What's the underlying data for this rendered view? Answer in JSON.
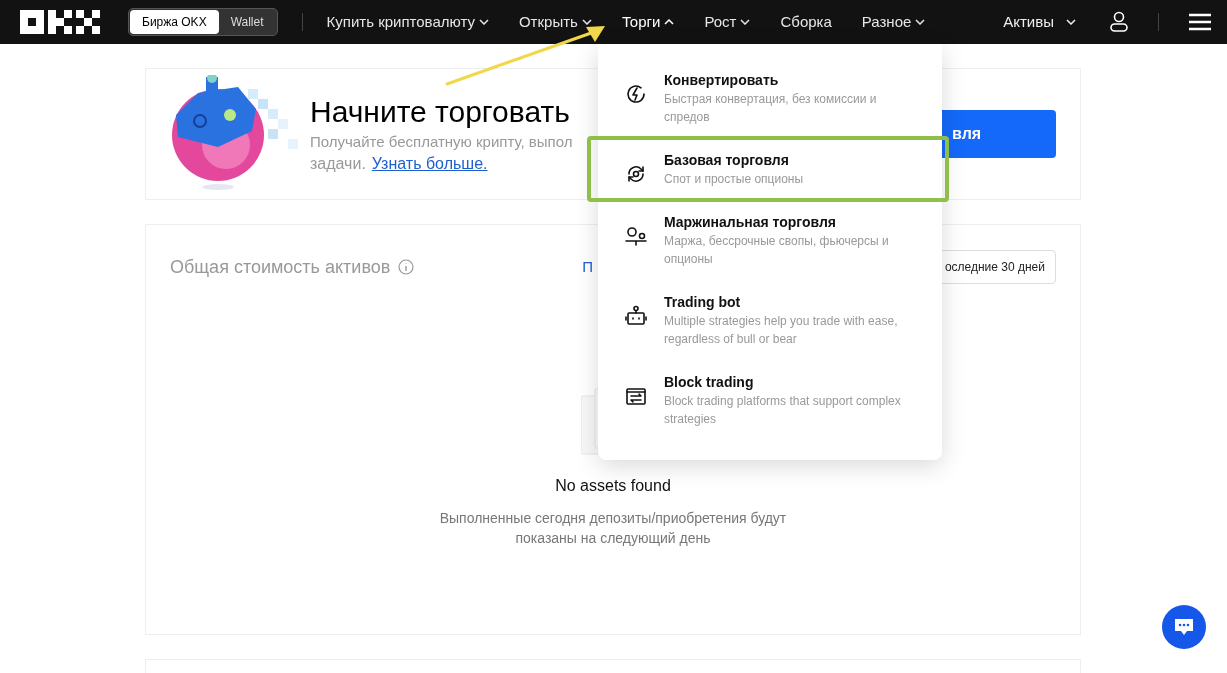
{
  "nav": {
    "exchange_toggle": [
      {
        "label": "Биржа OKX",
        "selected": true
      },
      {
        "label": "Wallet",
        "selected": false
      }
    ],
    "menu": [
      {
        "label": "Купить криптовалюту",
        "dropdown": true,
        "expanded": false
      },
      {
        "label": "Открыть",
        "dropdown": true,
        "expanded": false
      },
      {
        "label": "Торги",
        "dropdown": true,
        "expanded": true
      },
      {
        "label": "Рост",
        "dropdown": true,
        "expanded": false
      },
      {
        "label": "Сборка",
        "dropdown": false,
        "expanded": false
      },
      {
        "label": "Разное",
        "dropdown": true,
        "expanded": false
      }
    ],
    "assets": {
      "label": "Активы",
      "dropdown": true
    }
  },
  "promo": {
    "title": "Начните торговать",
    "text_line_1": "Получайте бесплатную крипту, выпол",
    "text_line_2": "задачи.",
    "link": "Узнать больше.",
    "button": "вля"
  },
  "assets_card": {
    "title": "Общая стоимость активов",
    "link": "П",
    "period_button": "оследние 30 дней",
    "empty_title": "No assets found",
    "empty_text": "Выполненные сегодня депозиты/приобретения будут показаны на следующий день"
  },
  "trade_menu": [
    {
      "kind": "convert",
      "title": "Конвертировать",
      "description": "Быстрая конвертация, без комиссии и спредов",
      "highlighted": false
    },
    {
      "kind": "basic",
      "title": "Базовая торговля",
      "description": "Спот и простые опционы",
      "highlighted": true
    },
    {
      "kind": "margin",
      "title": "Маржинальная торговля",
      "description": "Маржа, бессрочные свопы, фьючерсы и опционы",
      "highlighted": false
    },
    {
      "kind": "bot",
      "title": "Trading bot",
      "description": "Multiple strategies help you trade with ease, regardless of bull or bear",
      "highlighted": false
    },
    {
      "kind": "block",
      "title": "Block trading",
      "description": "Block trading platforms that support complex strategies",
      "highlighted": false
    }
  ]
}
